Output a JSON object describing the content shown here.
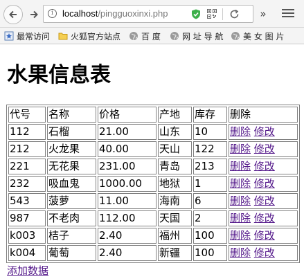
{
  "browser": {
    "url_host": "localhost",
    "url_path": "/pingguoxinxi.php",
    "bookmarks": [
      {
        "label": "最常访问",
        "icon": "bookmark-star-icon"
      },
      {
        "label": "火狐官方站点",
        "icon": "folder-icon"
      },
      {
        "label": "百 度",
        "icon": "globe-icon"
      },
      {
        "label": "网 址 导 航",
        "icon": "globe-icon"
      },
      {
        "label": "美 女 图 片",
        "icon": "globe-icon"
      }
    ]
  },
  "page": {
    "title": "水果信息表",
    "add_link": "添加数据"
  },
  "table": {
    "headers": [
      "代号",
      "名称",
      "价格",
      "产地",
      "库存",
      "删除"
    ],
    "rows": [
      {
        "code": "112",
        "name": "石榴",
        "price": "21.00",
        "origin": "山东",
        "stock": "10"
      },
      {
        "code": "212",
        "name": "火龙果",
        "price": "40.00",
        "origin": "天山",
        "stock": "122"
      },
      {
        "code": "221",
        "name": "无花果",
        "price": "231.00",
        "origin": "青岛",
        "stock": "213"
      },
      {
        "code": "232",
        "name": "吸血鬼",
        "price": "1000.00",
        "origin": "地狱",
        "stock": "1"
      },
      {
        "code": "543",
        "name": "菠萝",
        "price": "11.00",
        "origin": "海南",
        "stock": "6"
      },
      {
        "code": "987",
        "name": "不老肉",
        "price": "112.00",
        "origin": "天国",
        "stock": "2"
      },
      {
        "code": "k003",
        "name": "桔子",
        "price": "2.40",
        "origin": "福州",
        "stock": "100"
      },
      {
        "code": "k004",
        "name": "葡萄",
        "price": "2.40",
        "origin": "新疆",
        "stock": "100"
      }
    ],
    "delete_label": "删除",
    "edit_label": "修改"
  },
  "colors": {
    "visited_link": "#551a8b",
    "security_shield": "#3db04b"
  }
}
